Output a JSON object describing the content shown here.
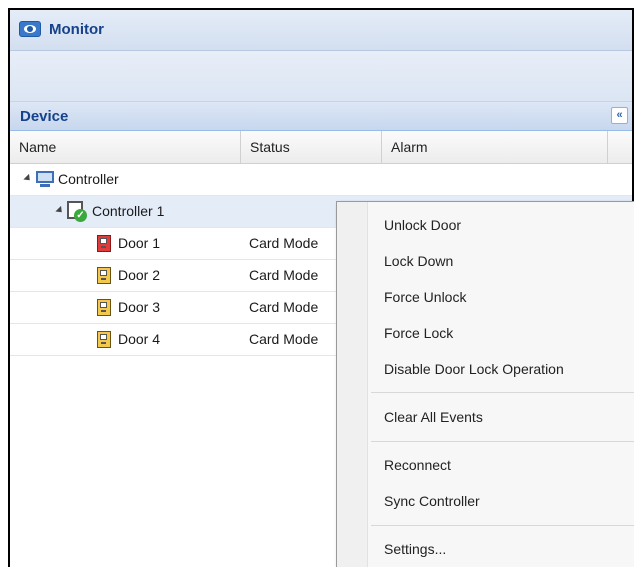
{
  "window": {
    "title": "Monitor",
    "icon": "eye-icon"
  },
  "panel": {
    "title": "Device",
    "collapse_label": "«",
    "collapse_icon": "double-chevron-left-icon"
  },
  "grid": {
    "columns": [
      "Name",
      "Status",
      "Alarm"
    ],
    "rows": [
      {
        "name": "Controller",
        "status": "",
        "alarm": "",
        "icon": "computer-icon"
      },
      {
        "name": "Controller 1",
        "status": "",
        "alarm": "",
        "icon": "controller-online-icon"
      },
      {
        "name": "Door 1",
        "status": "Card Mode",
        "alarm": "",
        "icon": "door-red-icon",
        "icon_color": "#e23b3b"
      },
      {
        "name": "Door 2",
        "status": "Card Mode",
        "alarm": "",
        "icon": "door-yellow-icon",
        "icon_color": "#f2c94c"
      },
      {
        "name": "Door 3",
        "status": "Card Mode",
        "alarm": "",
        "icon": "door-yellow-icon",
        "icon_color": "#f2c94c"
      },
      {
        "name": "Door 4",
        "status": "Card Mode",
        "alarm": "",
        "icon": "door-yellow-icon",
        "icon_color": "#f2c94c"
      }
    ]
  },
  "context_menu": {
    "items": [
      "Unlock Door",
      "Lock Down",
      "Force Unlock",
      "Force Lock",
      "Disable Door Lock Operation",
      "Clear All Events",
      "Reconnect",
      "Sync Controller",
      "Settings..."
    ]
  },
  "colors": {
    "accent": "#15428b",
    "header_bg": "#dde7f5",
    "selected_row": "#e4ecf8"
  }
}
